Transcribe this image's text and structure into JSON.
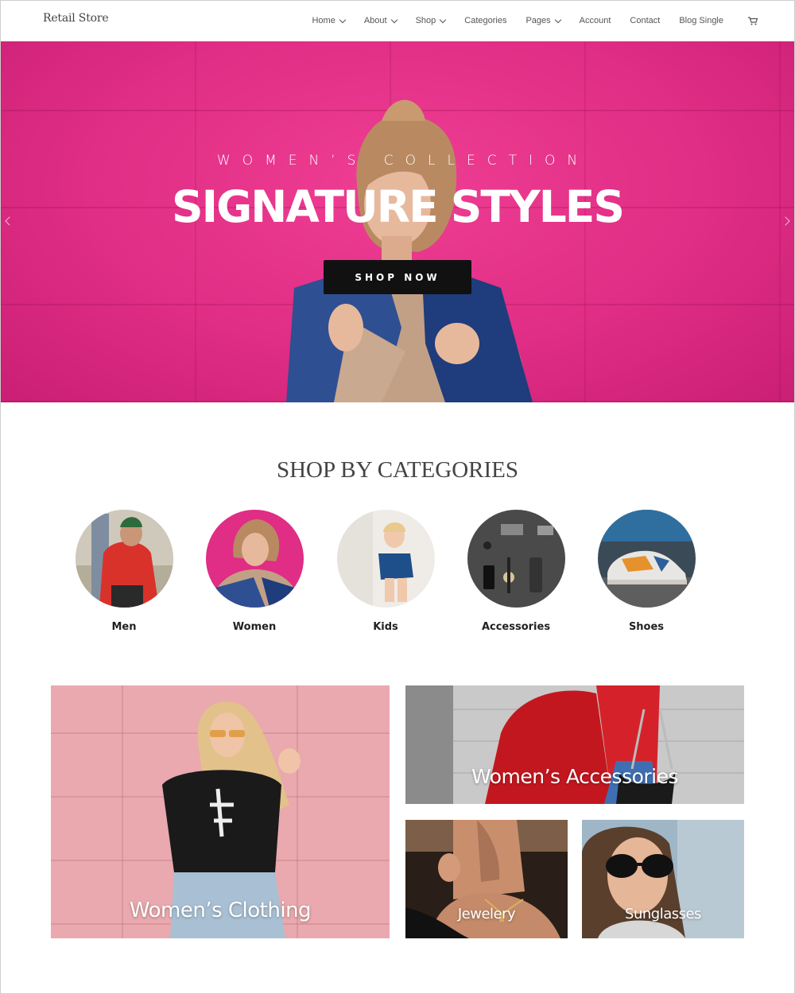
{
  "header": {
    "logo": "Retail Store",
    "nav": [
      {
        "label": "Home",
        "dropdown": true
      },
      {
        "label": "About",
        "dropdown": true
      },
      {
        "label": "Shop",
        "dropdown": true
      },
      {
        "label": "Categories",
        "dropdown": false
      },
      {
        "label": "Pages",
        "dropdown": true
      },
      {
        "label": "Account",
        "dropdown": false
      },
      {
        "label": "Contact",
        "dropdown": false
      },
      {
        "label": "Blog Single",
        "dropdown": false
      }
    ],
    "cart_icon": "cart-icon"
  },
  "hero": {
    "subtitle": "WOMEN’S COLLECTION",
    "title": "SIGNATURE STYLES",
    "button": "SHOP NOW",
    "background_color": "#e02d85"
  },
  "categories": {
    "title": "SHOP BY CATEGORIES",
    "items": [
      {
        "label": "Men"
      },
      {
        "label": "Women"
      },
      {
        "label": "Kids"
      },
      {
        "label": "Accessories"
      },
      {
        "label": "Shoes"
      }
    ]
  },
  "tiles": {
    "clothing": "Women’s Clothing",
    "accessories": "Women’s Accessories",
    "jewelery": "Jewelery",
    "sunglasses": "Sunglasses"
  }
}
